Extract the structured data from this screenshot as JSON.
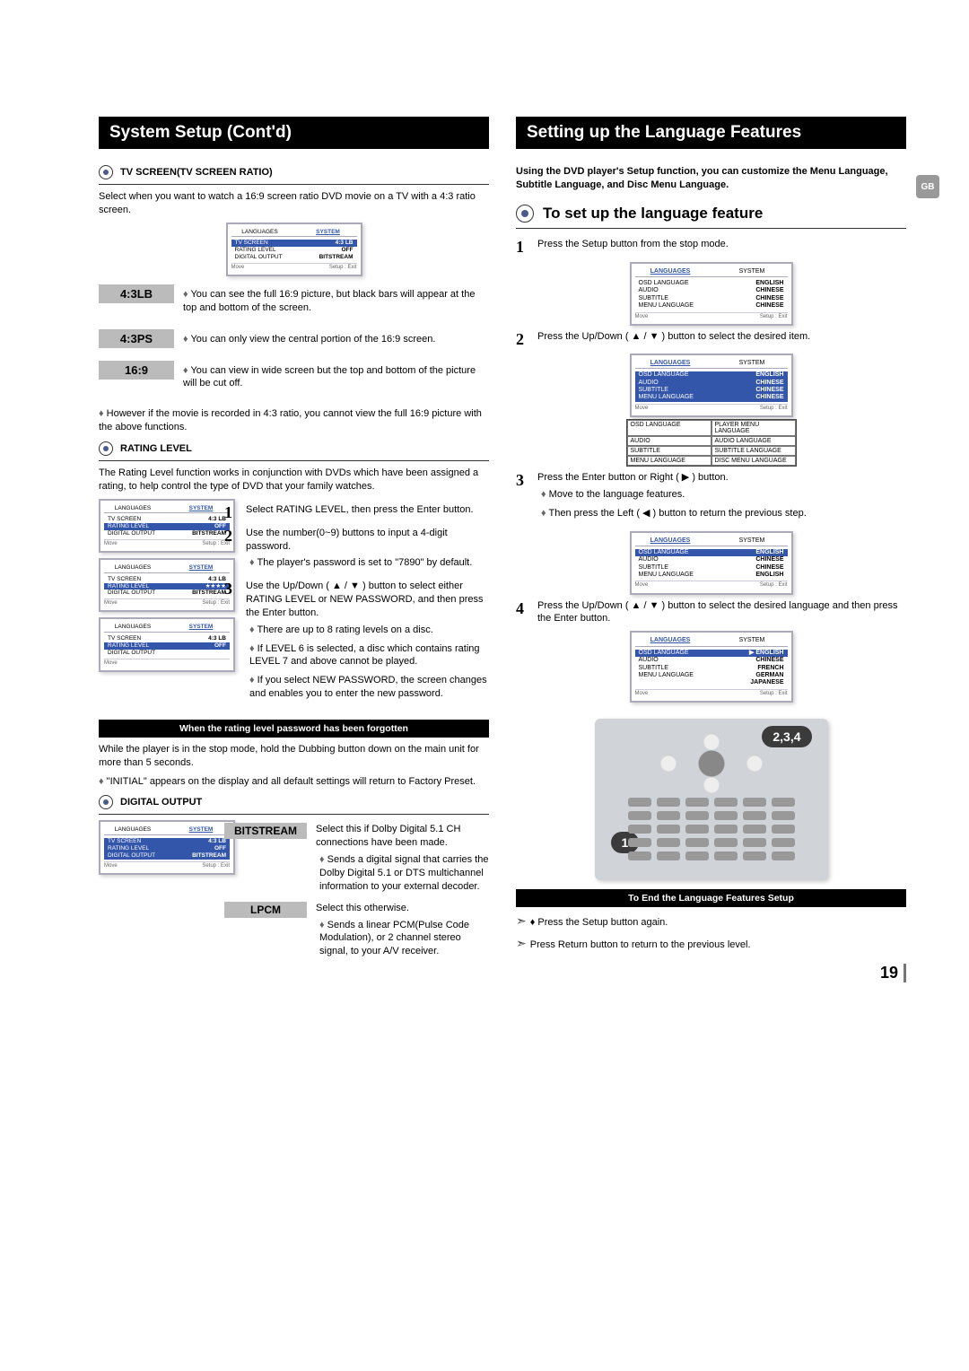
{
  "page_number": "19",
  "gb_label": "GB",
  "left": {
    "title": "System Setup (Cont'd)",
    "tv_section": {
      "heading": "TV SCREEN(TV SCREEN RATIO)",
      "intro": "Select when you want to watch a 16:9 screen ratio DVD movie on a TV with a 4:3 ratio screen.",
      "options": [
        {
          "label": "4:3LB",
          "desc": "You can see the full 16:9 picture, but black bars will appear at the top and bottom of the screen."
        },
        {
          "label": "4:3PS",
          "desc": "You can only view the central portion of the 16:9 screen."
        },
        {
          "label": "16:9",
          "desc": "You can view in wide screen  but the top and bottom of the  picture will be cut off."
        }
      ],
      "note": "However if the movie is recorded in 4:3 ratio, you cannot view the full 16:9 picture with the above functions."
    },
    "rating_section": {
      "heading": "RATING LEVEL",
      "intro": "The Rating Level function works in conjunction with DVDs which have been assigned a rating, to help control the type of DVD that your family watches.",
      "steps": [
        {
          "n": "1",
          "text": "Select RATING LEVEL, then press the Enter button."
        },
        {
          "n": "2",
          "text": "Use the number(0~9) buttons to input a 4-digit password.",
          "subs": [
            "The player's password is set to \"7890\" by default."
          ]
        },
        {
          "n": "3",
          "text": "Use the Up/Down ( ▲ / ▼ ) button to select either RATING LEVEL or NEW PASSWORD, and then press the Enter button.",
          "subs": [
            "There are up to 8 rating levels on a disc.",
            "If LEVEL 6 is selected, a disc which contains rating LEVEL 7 and above cannot be played.",
            "If you select NEW PASSWORD, the screen changes and enables you to enter the new password."
          ]
        }
      ],
      "forgot_strip": "When the rating level password has been forgotten",
      "forgot_text1": "While the player is in the stop mode, hold the Dubbing button down on the main unit for more than 5 seconds.",
      "forgot_text2": "\"INITIAL\" appears on the display and all default settings will return to Factory Preset."
    },
    "digital_section": {
      "heading": "DIGITAL OUTPUT",
      "options": [
        {
          "label": "BITSTREAM",
          "desc": "Select this if Dolby Digital 5.1 CH connections have been made.",
          "subs": [
            "Sends a digital signal that carries the Dolby Digital 5.1 or DTS multichannel information to your external decoder."
          ]
        },
        {
          "label": "LPCM",
          "desc": "Select this otherwise.",
          "subs": [
            "Sends a linear PCM(Pulse Code Modulation), or 2 channel stereo signal, to your A/V receiver."
          ]
        }
      ]
    },
    "menu_labels": {
      "tab_left": "LANGUAGES",
      "tab_right": "SYSTEM",
      "rows": {
        "tv_screen": "TV SCREEN",
        "rating_level": "RATING LEVEL",
        "digital_output": "DIGITAL OUTPUT"
      },
      "vals": {
        "tv": "4:3 LB",
        "rating": "OFF",
        "digital": "BITSTREAM"
      },
      "foot_left": "Move",
      "foot_right": "Setup : Exit"
    }
  },
  "right": {
    "title": "Setting up the Language Features",
    "intro": "Using the DVD player's Setup function, you can customize the Menu Language, Subtitle Language, and Disc Menu Language.",
    "big_heading": "To set up the language feature",
    "steps": [
      {
        "n": "1",
        "text": "Press the Setup button from the stop mode."
      },
      {
        "n": "2",
        "text": "Press the Up/Down ( ▲ / ▼ ) button  to select the desired item."
      },
      {
        "n": "3",
        "text": "Press the Enter button or Right ( ▶ ) button.",
        "subs": [
          "Move to the language features.",
          "Then press the Left ( ◀ ) button to return the previous step."
        ]
      },
      {
        "n": "4",
        "text": "Press the Up/Down ( ▲ / ▼ ) button to select the desired language and then press the Enter button."
      }
    ],
    "menu_labels": {
      "tab_left": "LANGUAGES",
      "tab_right": "SYSTEM",
      "rows": {
        "osd": "OSD LANGUAGE",
        "audio": "AUDIO",
        "subtitle": "SUBTITLE",
        "menu": "MENU LANGUAGE"
      },
      "vals1": {
        "osd": "ENGLISH",
        "audio": "CHINESE",
        "subtitle": "CHINESE",
        "menu": "CHINESE"
      },
      "vals3": {
        "osd": "ENGLISH",
        "audio": "CHINESE",
        "subtitle": "CHINESE",
        "menu": "ENGLISH"
      },
      "vals4": {
        "osd": "ENGLISH",
        "audio": "CHINESE",
        "subtitle": "FRENCH",
        "menu": "GERMAN",
        "extra": "JAPANESE"
      },
      "foot_left": "Move",
      "foot_right": "Setup : Exit"
    },
    "tooltip_table": [
      [
        "OSD LANGUAGE",
        "PLAYER MENU LANGUAGE"
      ],
      [
        "AUDIO",
        "AUDIO LANGUAGE"
      ],
      [
        "SUBTITLE",
        "SUBTITLE LANGUAGE"
      ],
      [
        "MENU LANGUAGE",
        "DISC MENU LANGUAGE"
      ]
    ],
    "bubble_top": "2,3,4",
    "bubble_bottom": "1",
    "end_strip": "To End the Language Features Setup",
    "end_text1": "Press the Setup button again.",
    "end_text2": "Press Return button to return to the previous level."
  }
}
